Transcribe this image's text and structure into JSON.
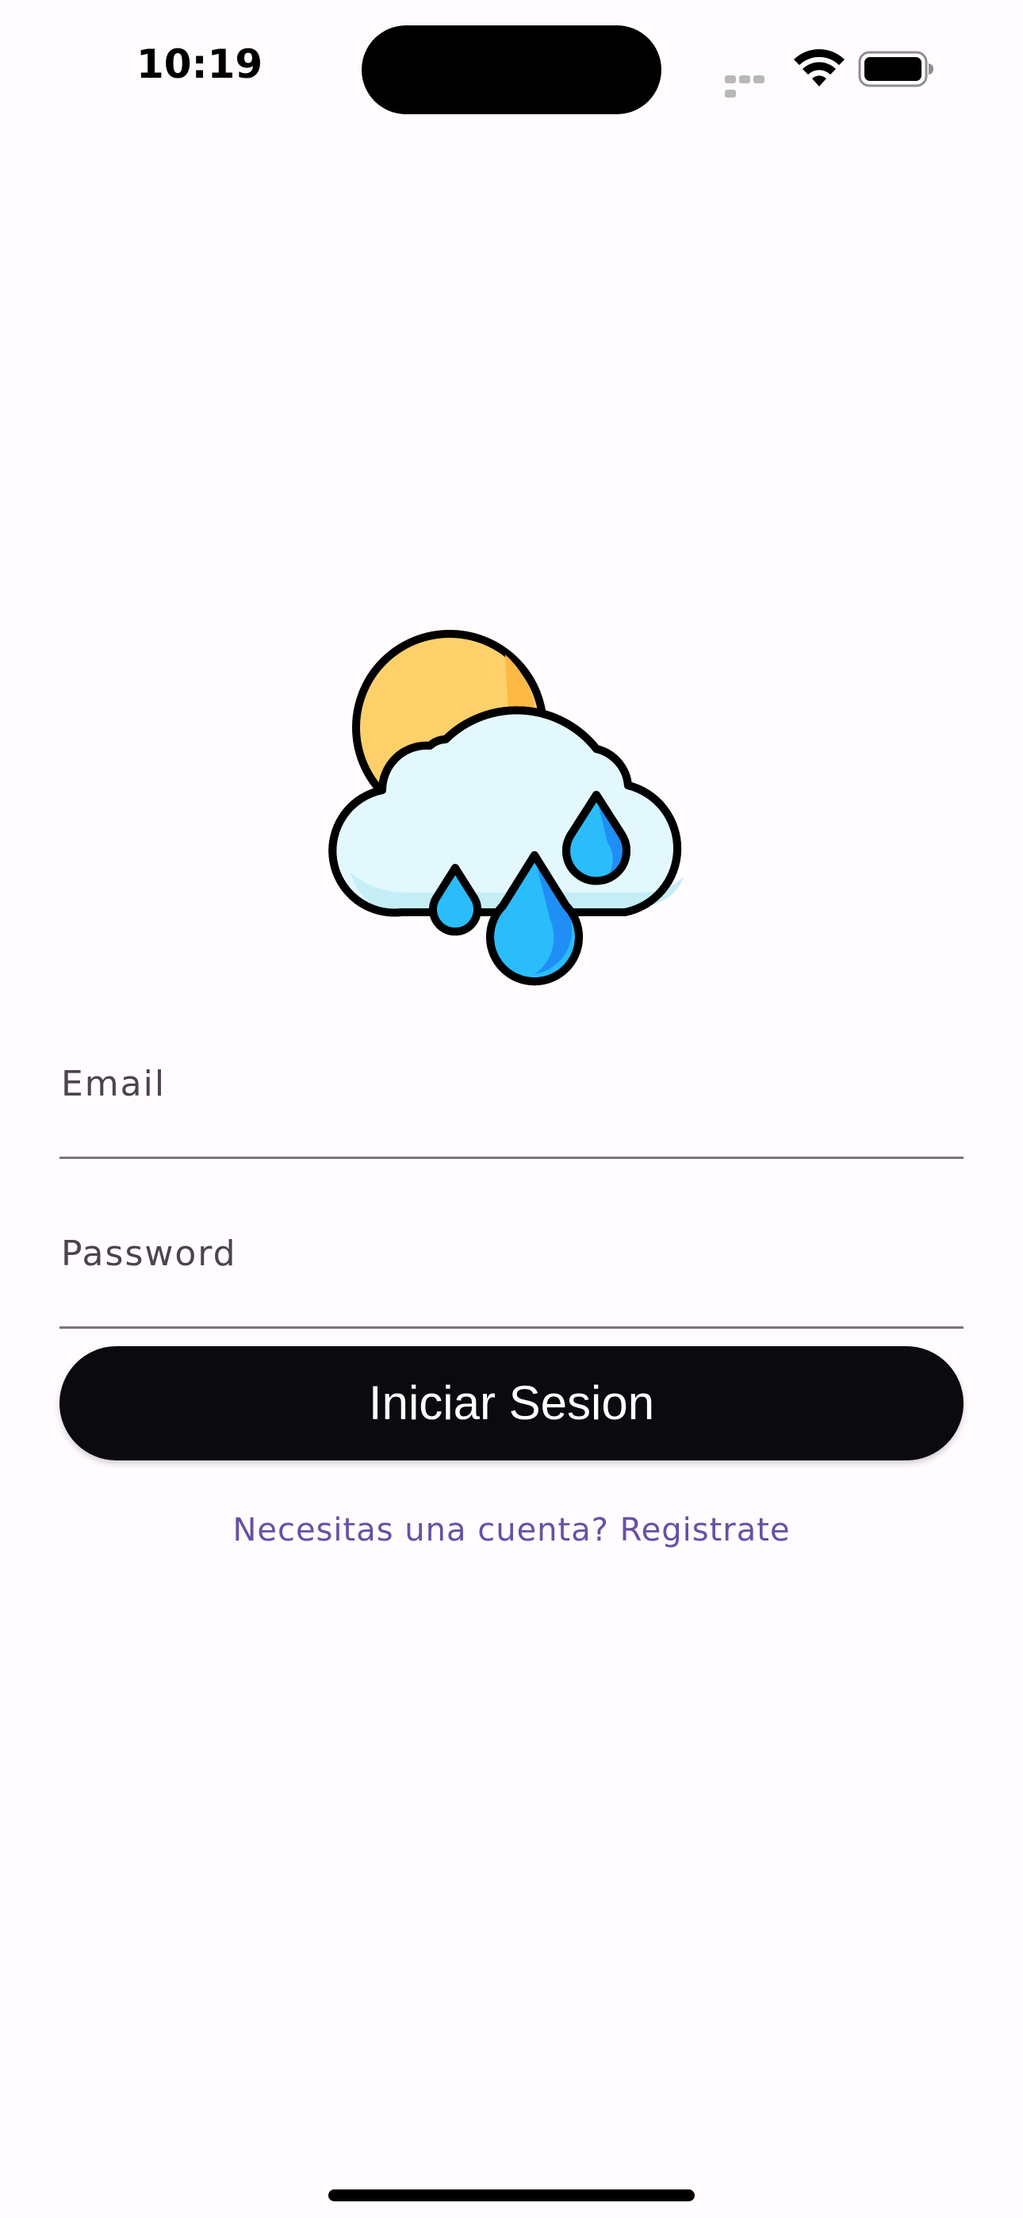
{
  "status_bar": {
    "time": "10:19",
    "icons": [
      "signal-icon",
      "wifi-icon",
      "battery-icon"
    ]
  },
  "logo": {
    "icon": "weather-rain-cloud-sun-icon"
  },
  "form": {
    "email": {
      "label": "Email",
      "value": ""
    },
    "password": {
      "label": "Password",
      "value": ""
    },
    "submit_label": "Iniciar Sesion",
    "register_link": "Necesitas una cuenta? Registrate"
  },
  "colors": {
    "background": "#fffbfe",
    "button": "#0b0a0e",
    "link": "#6750a4",
    "underline": "#79747e",
    "sun": "#fdd06a",
    "cloud": "#e2f8fc",
    "drop": "#2bbcfb"
  }
}
